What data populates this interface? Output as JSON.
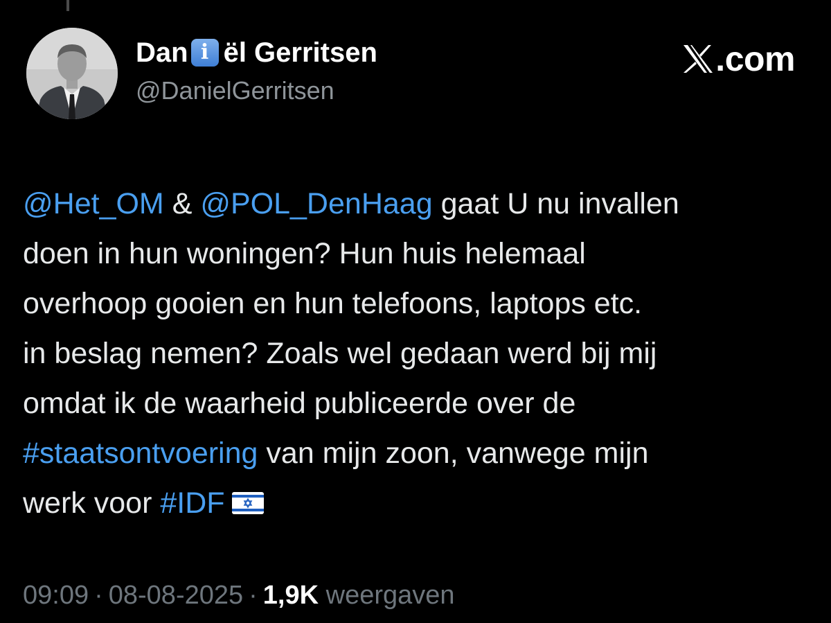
{
  "author": {
    "name_part1": "Dan",
    "badge_symbol": "i",
    "name_part2": "ël Gerritsen",
    "handle": "@DanielGerritsen"
  },
  "brand": {
    "text": ".com",
    "logo_icon": "x-logo-icon"
  },
  "tweet": {
    "line1": {
      "mention1": "@Het_OM",
      "amp": " & ",
      "mention2": "@POL_DenHaag",
      "rest": " gaat U nu invallen"
    },
    "line2": "doen in hun woningen? Hun huis helemaal",
    "line3": "overhoop gooien en hun telefoons, laptops etc.",
    "line4": "in beslag nemen? Zoals wel gedaan werd bij mij",
    "line5": "omdat ik de waarheid publiceerde over de",
    "line6": {
      "hashtag": "#staatsontvoering",
      "rest": " van mijn zoon, vanwege mijn"
    },
    "line7": {
      "text": "werk voor ",
      "hashtag": "#IDF",
      "flag_icon": "israel-flag-icon"
    }
  },
  "meta": {
    "time": "09:09",
    "dot": "·",
    "date": "08-08-2025",
    "views_count": "1,9K",
    "views_label": "weergaven"
  },
  "colors": {
    "background": "#000000",
    "text": "#e7e9ea",
    "link": "#4a9ff0",
    "muted": "#6e767d",
    "badge": "#4a86d9"
  }
}
